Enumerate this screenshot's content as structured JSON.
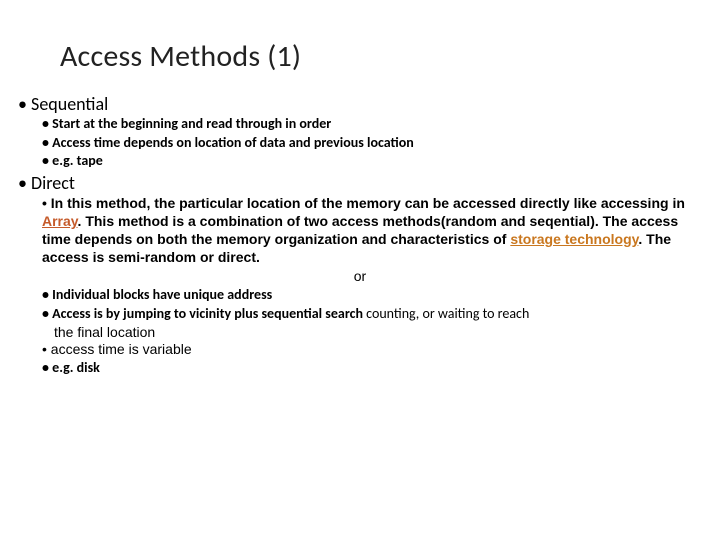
{
  "title": "Access Methods (1)",
  "sequential": {
    "heading": "Sequential",
    "items": [
      "Start at the beginning and read through in order",
      "Access time depends on location of data and previous location",
      "e.g. tape"
    ]
  },
  "direct": {
    "heading": "Direct",
    "long_para_pre1": "In this method, the particular location of the memory can be accessed directly like accessing in ",
    "long_para_link1": "Array",
    "long_para_mid": ". This method is a combination of two access methods(random and seqential). The access time depends on both the memory organization and characteristics of ",
    "long_para_link2": "storage technology",
    "long_para_post": ". The access is semi-random or direct.",
    "or_label": "or",
    "item_unique": "Individual blocks have unique address",
    "item_jump_pre": "Access is by jumping to vicinity plus sequential search",
    "item_jump_tail": " counting, or waiting to reach",
    "jump_continue": "the final location",
    "item_time": "access time is variable",
    "item_eg": "e.g. disk"
  }
}
